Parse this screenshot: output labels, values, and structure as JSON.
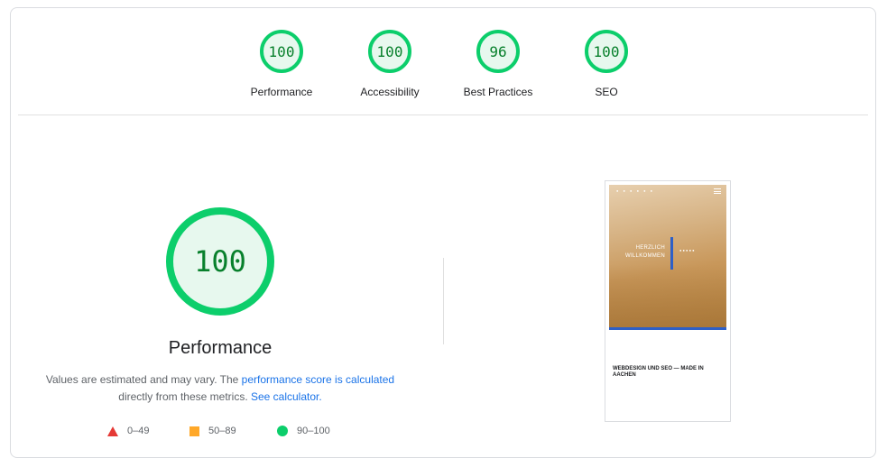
{
  "summary": {
    "categories": [
      {
        "score": "100",
        "label": "Performance"
      },
      {
        "score": "100",
        "label": "Accessibility"
      },
      {
        "score": "96",
        "label": "Best Practices"
      },
      {
        "score": "100",
        "label": "SEO"
      }
    ]
  },
  "performance": {
    "score": "100",
    "title": "Performance",
    "desc_prefix": "Values are estimated and may vary. The ",
    "desc_link_1": "performance score is calculated",
    "desc_middle": " directly from these metrics. ",
    "desc_link_2": "See calculator.",
    "legend": [
      {
        "icon": "triangle",
        "range": "0–49",
        "color": "#e53935"
      },
      {
        "icon": "square",
        "range": "50–89",
        "color": "#ffa829"
      },
      {
        "icon": "circle",
        "range": "90–100",
        "color": "#0cce6b"
      }
    ]
  },
  "thumbnail": {
    "logo": "● ● ● ● ● ●",
    "greeting_line1": "HERZLICH",
    "greeting_line2": "WILLKOMMEN",
    "sublogo_line1": "● ● ● ● ●",
    "sublogo_line2": "",
    "heading": "WEBDESIGN UND SEO — MADE IN AACHEN",
    "body": ""
  },
  "colors": {
    "pass": "#0cce6b",
    "pass_text": "#08802c",
    "link": "#1a73e8"
  }
}
